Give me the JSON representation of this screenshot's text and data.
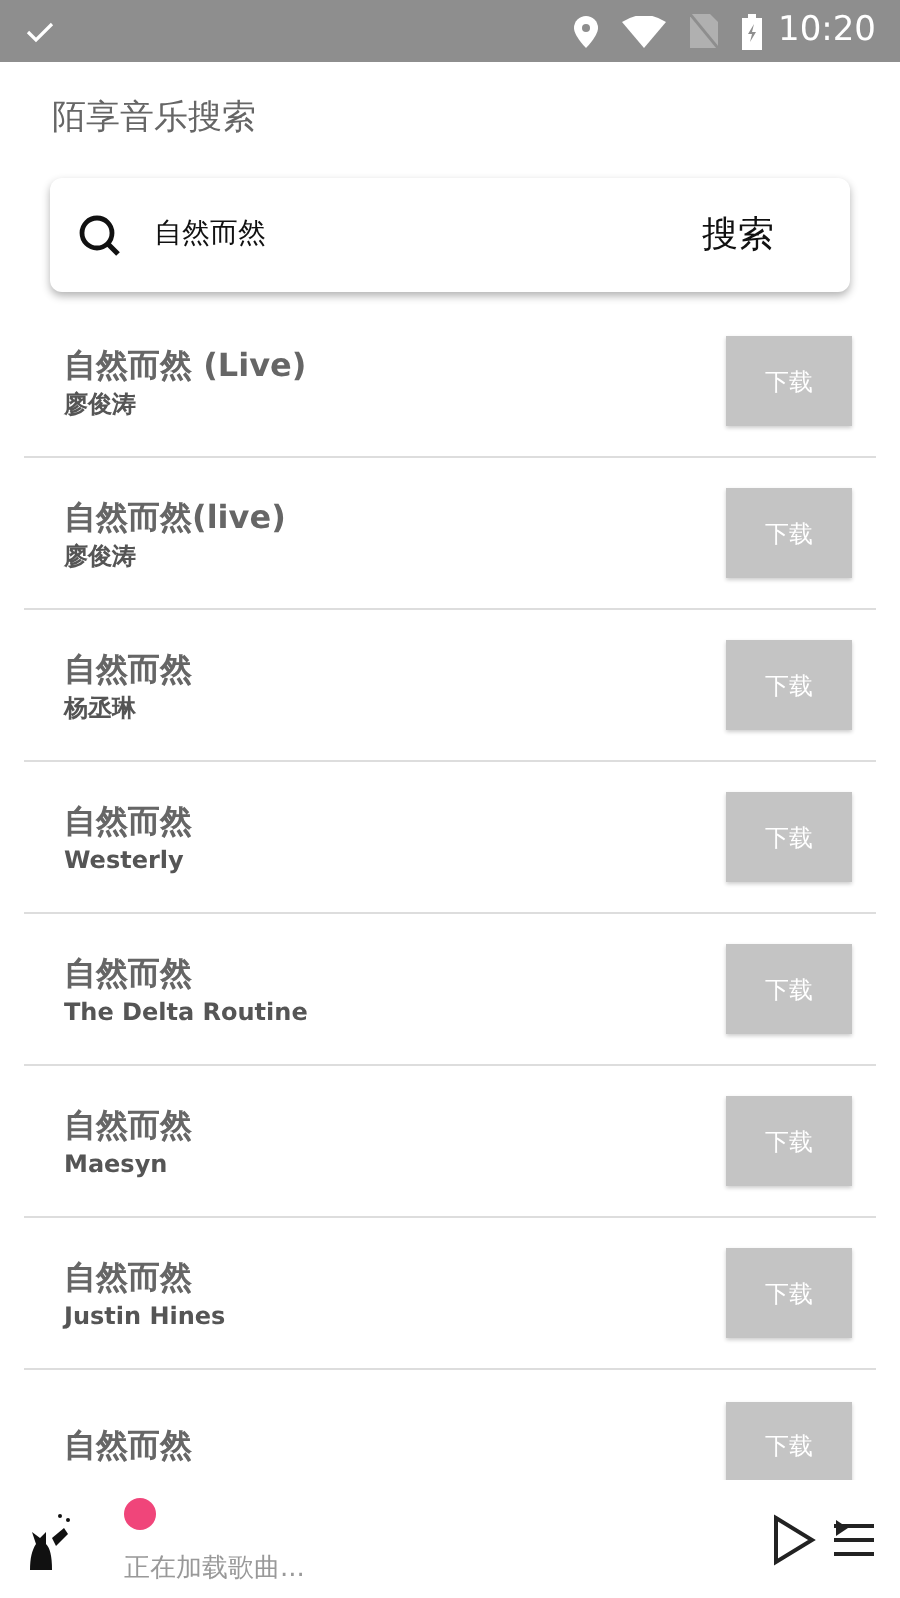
{
  "status_bar": {
    "time": "10:20"
  },
  "title": "陌享音乐搜索",
  "search": {
    "value": "自然而然",
    "button": "搜索"
  },
  "songs": [
    {
      "title": "自然而然 (Live)",
      "artist": "廖俊涛",
      "button": "下载"
    },
    {
      "title": "自然而然(live)",
      "artist": "廖俊涛",
      "button": "下载"
    },
    {
      "title": "自然而然",
      "artist": "杨丞琳",
      "button": "下载"
    },
    {
      "title": "自然而然",
      "artist": "Westerly",
      "button": "下载"
    },
    {
      "title": "自然而然",
      "artist": "The Delta Routine",
      "button": "下载"
    },
    {
      "title": "自然而然",
      "artist": "Maesyn",
      "button": "下载"
    },
    {
      "title": "自然而然",
      "artist": "Justin Hines",
      "button": "下载"
    },
    {
      "title": "自然而然",
      "button": "下载"
    }
  ],
  "player": {
    "status": "正在加载歌曲..."
  }
}
